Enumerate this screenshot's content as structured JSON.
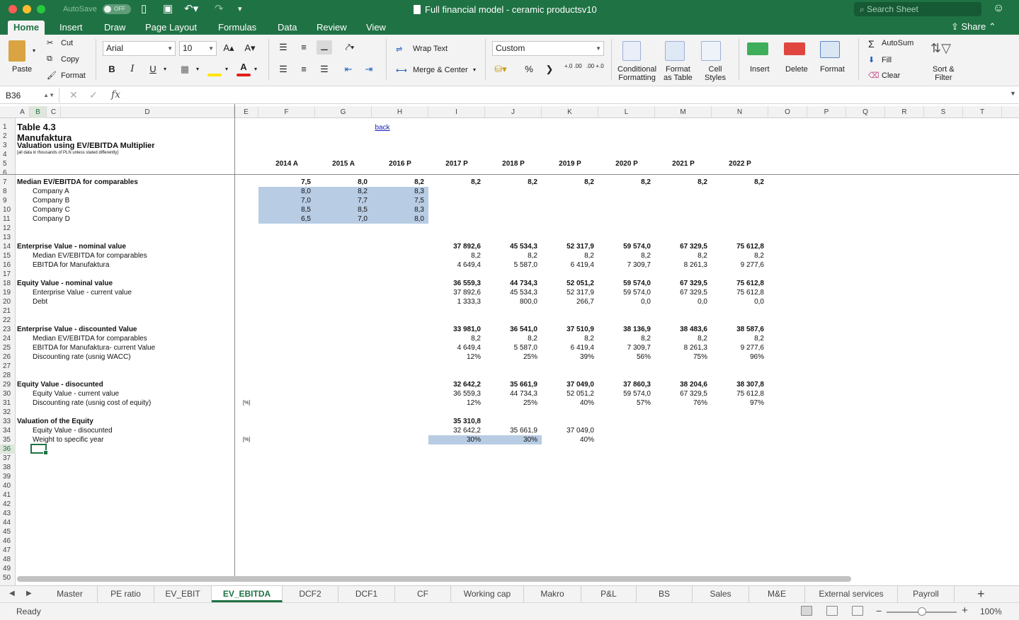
{
  "window": {
    "autosave_label": "AutoSave",
    "autosave_state": "OFF",
    "title": "Full financial model - ceramic productsv10",
    "search_placeholder": "Search Sheet"
  },
  "ribbon_tabs": [
    "Home",
    "Insert",
    "Draw",
    "Page Layout",
    "Formulas",
    "Data",
    "Review",
    "View"
  ],
  "share_label": "Share",
  "ribbon": {
    "paste": "Paste",
    "cut": "Cut",
    "copy": "Copy",
    "format_painter": "Format",
    "font_name": "Arial",
    "font_size": "10",
    "bold": "B",
    "italic": "I",
    "underline": "U",
    "font_color_letter": "A",
    "wrap_text": "Wrap Text",
    "merge_center": "Merge & Center",
    "number_format": "Custom",
    "percent": "%",
    "comma": "❯",
    "inc_decimal": "+.0 .00",
    "dec_decimal": ".00 +.0",
    "conditional_formatting": [
      "Conditional",
      "Formatting"
    ],
    "format_as_table": [
      "Format",
      "as Table"
    ],
    "cell_styles": [
      "Cell",
      "Styles"
    ],
    "insert": "Insert",
    "delete": "Delete",
    "format": "Format",
    "autosum": "AutoSum",
    "fill": "Fill",
    "clear": "Clear",
    "sort_filter": [
      "Sort &",
      "Filter"
    ]
  },
  "formula_bar": {
    "name_box": "B36",
    "fx": "fx",
    "formula": ""
  },
  "columns": [
    "A",
    "B",
    "C",
    "D",
    "E",
    "F",
    "G",
    "H",
    "I",
    "J",
    "K",
    "L",
    "M",
    "N",
    "O",
    "P",
    "Q",
    "R",
    "S",
    "T"
  ],
  "rows": [
    "1",
    "2",
    "3",
    "4",
    "5",
    "6",
    "7",
    "8",
    "9",
    "10",
    "11",
    "12",
    "13",
    "14",
    "15",
    "16",
    "17",
    "18",
    "19",
    "20",
    "21",
    "22",
    "23",
    "24",
    "25",
    "26",
    "27",
    "28",
    "29",
    "30",
    "31",
    "32",
    "33",
    "34",
    "35",
    "36",
    "37",
    "38",
    "39",
    "40",
    "41",
    "42",
    "43",
    "44",
    "45",
    "46",
    "47",
    "48",
    "49",
    "50"
  ],
  "sheet": {
    "title1": "Table 4.3",
    "title2": "Manufaktura",
    "title3": "Valuation using EV/EBITDA Multiplier",
    "note": "[all data in thousands of PLN unless stated differently]",
    "back": "back",
    "years": [
      "2014 A",
      "2015 A",
      "2016 P",
      "2017 P",
      "2018 P",
      "2019 P",
      "2020 P",
      "2021 P",
      "2022 P"
    ],
    "r7": {
      "label": "Median EV/EBITDA for comparables",
      "vals": [
        "7,5",
        "8,0",
        "8,2",
        "8,2",
        "8,2",
        "8,2",
        "8,2",
        "8,2",
        "8,2"
      ]
    },
    "r8": {
      "label": "Company A",
      "vals": [
        "8,0",
        "8,2",
        "8,3"
      ]
    },
    "r9": {
      "label": "Company B",
      "vals": [
        "7,0",
        "7,7",
        "7,5"
      ]
    },
    "r10": {
      "label": "Company C",
      "vals": [
        "8,5",
        "8,5",
        "8,3"
      ]
    },
    "r11": {
      "label": "Company D",
      "vals": [
        "6,5",
        "7,0",
        "8,0"
      ]
    },
    "r14": {
      "label": "Enterprise Value - nominal value",
      "vals": [
        "37 892,6",
        "45 534,3",
        "52 317,9",
        "59 574,0",
        "67 329,5",
        "75 612,8"
      ]
    },
    "r15": {
      "label": "Median EV/EBITDA for comparables",
      "vals": [
        "8,2",
        "8,2",
        "8,2",
        "8,2",
        "8,2",
        "8,2"
      ]
    },
    "r16": {
      "label": "EBITDA for Manufaktura",
      "vals": [
        "4 649,4",
        "5 587,0",
        "6 419,4",
        "7 309,7",
        "8 261,3",
        "9 277,6"
      ]
    },
    "r18": {
      "label": "Equity Value - nominal value",
      "vals": [
        "36 559,3",
        "44 734,3",
        "52 051,2",
        "59 574,0",
        "67 329,5",
        "75 612,8"
      ]
    },
    "r19": {
      "label": "Enterprise Value - current value",
      "vals": [
        "37 892,6",
        "45 534,3",
        "52 317,9",
        "59 574,0",
        "67 329,5",
        "75 612,8"
      ]
    },
    "r20": {
      "label": "Debt",
      "vals": [
        "1 333,3",
        "800,0",
        "266,7",
        "0,0",
        "0,0",
        "0,0"
      ]
    },
    "r23": {
      "label": "Enterprise Value - discounted Value",
      "vals": [
        "33 981,0",
        "36 541,0",
        "37 510,9",
        "38 136,9",
        "38 483,6",
        "38 587,6"
      ]
    },
    "r24": {
      "label": "Median EV/EBITDA for comparables",
      "vals": [
        "8,2",
        "8,2",
        "8,2",
        "8,2",
        "8,2",
        "8,2"
      ]
    },
    "r25": {
      "label": "EBITDA for Manufaktura- current Value",
      "vals": [
        "4 649,4",
        "5 587,0",
        "6 419,4",
        "7 309,7",
        "8 261,3",
        "9 277,6"
      ]
    },
    "r26": {
      "label": "Discounting rate (usnig WACC)",
      "vals": [
        "12%",
        "25%",
        "39%",
        "56%",
        "75%",
        "96%"
      ]
    },
    "r29": {
      "label": "Equity Value - disocunted",
      "vals": [
        "32 642,2",
        "35 661,9",
        "37 049,0",
        "37 860,3",
        "38 204,6",
        "38 307,8"
      ]
    },
    "r30": {
      "label": "Equity Value - current value",
      "vals": [
        "36 559,3",
        "44 734,3",
        "52 051,2",
        "59 574,0",
        "67 329,5",
        "75 612,8"
      ]
    },
    "r31": {
      "label": "Discounting rate (usnig cost of equity)",
      "unit": "[%]",
      "vals": [
        "12%",
        "25%",
        "40%",
        "57%",
        "76%",
        "97%"
      ]
    },
    "r33": {
      "label": "Valuation of the Equity",
      "vals": [
        "35 310,8"
      ]
    },
    "r34": {
      "label": "Equity Value - disocunted",
      "vals": [
        "32 642,2",
        "35 661,9",
        "37 049,0"
      ]
    },
    "r35": {
      "label": "Weight to specific year",
      "unit": "[%]",
      "vals": [
        "30%",
        "30%",
        "40%"
      ]
    }
  },
  "sheet_tabs": [
    "Master",
    "PE ratio",
    "EV_EBIT",
    "EV_EBITDA",
    "DCF2",
    "DCF1",
    "CF",
    "Working cap",
    "Makro",
    "P&L",
    "BS",
    "Sales",
    "M&E",
    "External services",
    "Payroll"
  ],
  "active_sheet": "EV_EBITDA",
  "status": {
    "text": "Ready",
    "zoom": "100%"
  },
  "colors": {
    "brand": "#1f7244",
    "selection": "#b8cce4"
  }
}
